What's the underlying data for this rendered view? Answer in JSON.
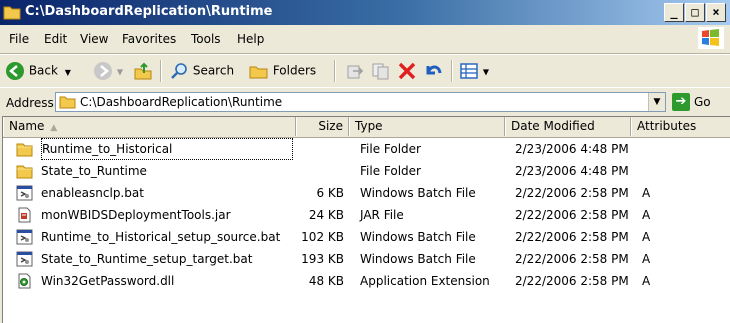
{
  "window": {
    "title": "C:\\DashboardReplication\\Runtime",
    "controls": [
      "_",
      "□",
      "×"
    ]
  },
  "menu": [
    "File",
    "Edit",
    "View",
    "Favorites",
    "Tools",
    "Help"
  ],
  "toolbar": {
    "back_label": "Back",
    "search_label": "Search",
    "folders_label": "Folders"
  },
  "address": {
    "label": "Address",
    "value": "C:\\DashboardReplication\\Runtime",
    "go_label": "Go"
  },
  "columns": {
    "name": "Name",
    "size": "Size",
    "type": "Type",
    "modified": "Date Modified",
    "attributes": "Attributes"
  },
  "files": [
    {
      "icon": "folder-icon",
      "name": "Runtime_to_Historical",
      "size": "",
      "type": "File Folder",
      "modified": "2/23/2006 4:48 PM",
      "attr": ""
    },
    {
      "icon": "folder-icon",
      "name": "State_to_Runtime",
      "size": "",
      "type": "File Folder",
      "modified": "2/23/2006 4:48 PM",
      "attr": ""
    },
    {
      "icon": "batch-file-icon",
      "name": "enableasnclp.bat",
      "size": "6 KB",
      "type": "Windows Batch File",
      "modified": "2/22/2006 2:58 PM",
      "attr": "A"
    },
    {
      "icon": "jar-file-icon",
      "name": "monWBIDSDeploymentTools.jar",
      "size": "24 KB",
      "type": "JAR File",
      "modified": "2/22/2006 2:58 PM",
      "attr": "A"
    },
    {
      "icon": "batch-file-icon",
      "name": "Runtime_to_Historical_setup_source.bat",
      "size": "102 KB",
      "type": "Windows Batch File",
      "modified": "2/22/2006 2:58 PM",
      "attr": "A"
    },
    {
      "icon": "batch-file-icon",
      "name": "State_to_Runtime_setup_target.bat",
      "size": "193 KB",
      "type": "Windows Batch File",
      "modified": "2/22/2006 2:58 PM",
      "attr": "A"
    },
    {
      "icon": "dll-file-icon",
      "name": "Win32GetPassword.dll",
      "size": "48 KB",
      "type": "Application Extension",
      "modified": "2/22/2006 2:58 PM",
      "attr": "A"
    }
  ]
}
